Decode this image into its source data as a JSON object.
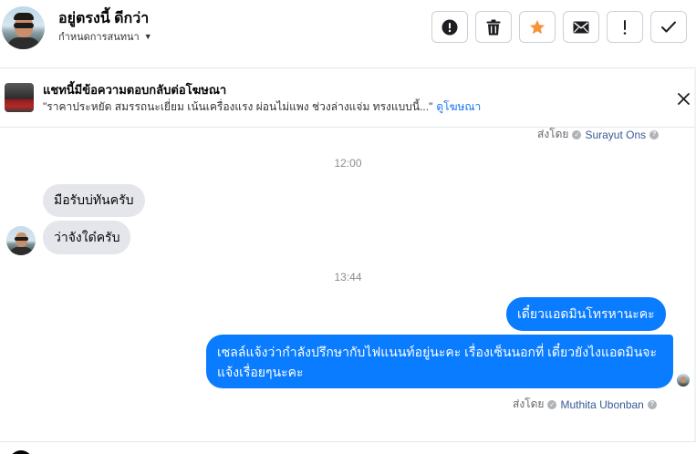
{
  "header": {
    "contact_name": "อยู่ตรงนี้ ดีกว่า",
    "conversation_menu": "กำหนดการสนทนา",
    "toolbar": [
      {
        "name": "mark-spam-button",
        "icon": "alert-circle-icon"
      },
      {
        "name": "delete-button",
        "icon": "trash-icon"
      },
      {
        "name": "star-button",
        "icon": "star-icon"
      },
      {
        "name": "mark-unread-button",
        "icon": "envelope-icon"
      },
      {
        "name": "flag-button",
        "icon": "exclamation-icon"
      },
      {
        "name": "mark-done-button",
        "icon": "checkmark-icon"
      }
    ],
    "star_color": "#f7923a"
  },
  "ad_banner": {
    "title": "แชทนี้มีข้อความตอบกลับต่อโฆษณา",
    "text": "\"ราคาประหยัด สมรรถนะเยี่ยม เน้นเครื่องแรง ผ่อนไม่แพง ช่วงล่างแจ่ม ทรงแบบนี้...\"",
    "link": "ดูโฆษณา"
  },
  "messages": {
    "sent_by_top": {
      "label": "ส่งโดย",
      "name": "Surayut Ons"
    },
    "time_1": "12:00",
    "incoming": [
      {
        "text": "มือรับบ่ทันครับ"
      },
      {
        "text": "ว่าจังใด๋ครับ"
      }
    ],
    "time_2": "13:44",
    "outgoing": [
      {
        "text": "เดี๋ยวแอดมินโทรหานะคะ"
      },
      {
        "text": "เซลล์แจ้งว่ากำลังปรึกษากับไฟแนนท์อยู่นะคะ เรื่องเซ็นนอกที่ เดี๋ยวยังไงแอดมินจะแจ้งเรื่อยๆนะคะ"
      }
    ],
    "sent_by_bottom": {
      "label": "ส่งโดย",
      "name": "Muthita Ubonban"
    },
    "outgoing_color": "#0a7cff"
  }
}
